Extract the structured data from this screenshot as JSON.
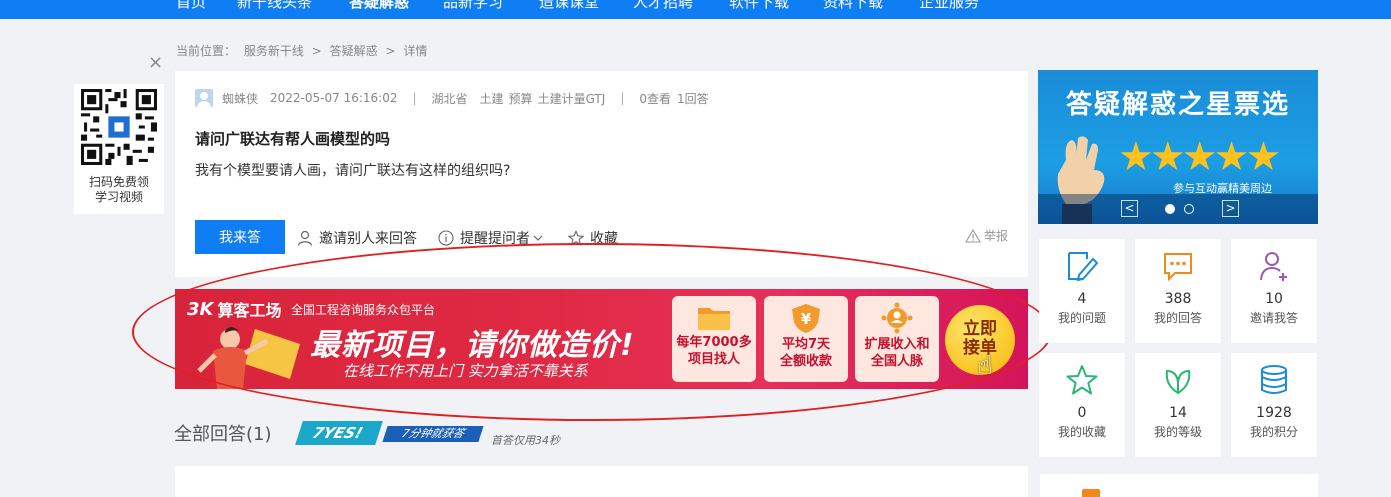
{
  "topnav": {
    "items": [
      "首页",
      "新干线头条",
      "答疑解惑",
      "品新学习",
      "造课课堂",
      "人才招聘",
      "软件下载",
      "资料下载",
      "企业服务"
    ],
    "active_index": 2,
    "bg_color": "#0f7ef5"
  },
  "breadcrumb": {
    "label": "当前位置：",
    "items": [
      "服务新干线",
      "答疑解惑",
      "详情"
    ],
    "separator": ">"
  },
  "qr": {
    "close": "×",
    "text_line1": "扫码免费领",
    "text_line2": "学习视频"
  },
  "question": {
    "author": "蜘蛛侠",
    "datetime": "2022-05-07 16:16:02",
    "sep": "|",
    "region": "湖北省",
    "tags": [
      "土建",
      "预算",
      "土建计量GTJ"
    ],
    "views": "0查看",
    "answers": "1回答",
    "title": "请问广联达有帮人画模型的吗",
    "body": "我有个模型要请人画，请问广联达有这样的组织吗?",
    "answer_button": "我来答",
    "invite": "邀请别人来回答",
    "remind": "提醒提问者",
    "favorite": "收藏",
    "report": "举报"
  },
  "ad": {
    "logo": "算客工场",
    "logo_mark": "3K",
    "tagline": "全国工程咨询服务众包平台",
    "headline": "最新项目，请你做造价!",
    "sub": "在线工作不用上门    实力拿活不靠关系",
    "features": [
      {
        "line1": "每年7000多",
        "line2": "项目找人",
        "icon": "folder-icon"
      },
      {
        "line1": "平均7天",
        "line2": "全额收款",
        "icon": "yen-shield-icon"
      },
      {
        "line1": "扩展收入和",
        "line2": "全国人脉",
        "icon": "network-icon"
      }
    ],
    "cta_line1": "立即",
    "cta_line2": "接单",
    "accent": "#e02a45"
  },
  "answers": {
    "heading": "全部回答(1)",
    "badge_main": "7YES!",
    "badge_sub": "7分钟就获答",
    "first_answer": "首答仅用34秒"
  },
  "side_banner": {
    "title": "答疑解惑之星票选",
    "subtitle": "参与互动赢精美周边",
    "stars": "★★★★★",
    "prev": "<",
    "next": ">"
  },
  "stats": [
    {
      "num": "4",
      "label": "我的问题",
      "icon": "edit-icon",
      "color": "#1a8cd8"
    },
    {
      "num": "388",
      "label": "我的回答",
      "icon": "chat-icon",
      "color": "#f08a1c"
    },
    {
      "num": "10",
      "label": "邀请我答",
      "icon": "add-user-icon",
      "color": "#9b59b6"
    },
    {
      "num": "0",
      "label": "我的收藏",
      "icon": "star-icon",
      "color": "#2bb673"
    },
    {
      "num": "14",
      "label": "我的等级",
      "icon": "leaf-icon",
      "color": "#2bb673"
    },
    {
      "num": "1928",
      "label": "我的积分",
      "icon": "coins-icon",
      "color": "#1a8cd8"
    }
  ]
}
